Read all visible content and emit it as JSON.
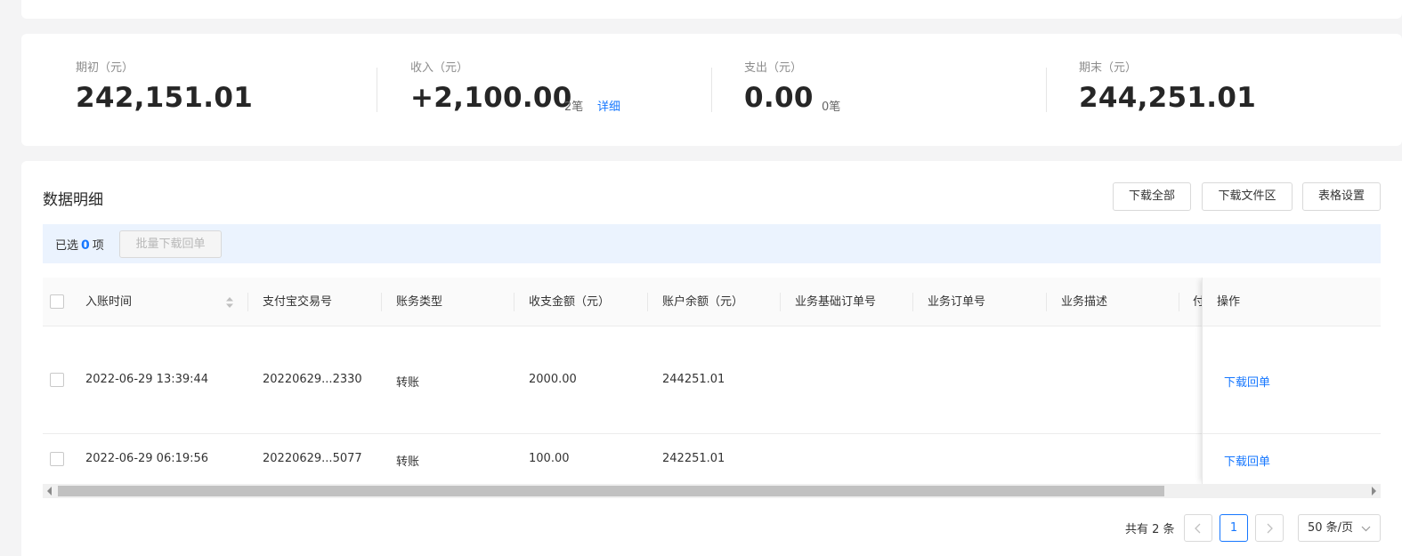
{
  "summary": {
    "opening": {
      "label": "期初（元）",
      "value": "242,151.01"
    },
    "income": {
      "label": "收入（元）",
      "value": "+2,100.00",
      "count": "2笔",
      "detail_link": "详细"
    },
    "expense": {
      "label": "支出（元）",
      "value": "0.00",
      "count": "0笔"
    },
    "closing": {
      "label": "期末（元）",
      "value": "244,251.01"
    }
  },
  "details": {
    "title": "数据明细",
    "buttons": {
      "download_all": "下载全部",
      "download_files": "下载文件区",
      "table_settings": "表格设置"
    },
    "selection": {
      "prefix": "已选",
      "count": "0",
      "suffix": "项",
      "batch_button": "批量下载回单"
    }
  },
  "table": {
    "columns": [
      "入账时间",
      "支付宝交易号",
      "账务类型",
      "收支金额（元）",
      "账户余额（元）",
      "业务基础订单号",
      "业务订单号",
      "业务描述",
      "付"
    ],
    "action_column": "操作",
    "rows": [
      {
        "time": "2022-06-29 13:39:44",
        "trade_no": "20220629...2330",
        "type": "转账",
        "amount": "2000.00",
        "balance": "244251.01",
        "action": "下载回单"
      },
      {
        "time": "2022-06-29 06:19:56",
        "trade_no": "20220629...5077",
        "type": "转账",
        "amount": "100.00",
        "balance": "242251.01",
        "action": "下载回单"
      }
    ]
  },
  "pagination": {
    "total": "共有 2 条",
    "current": "1",
    "page_size": "50 条/页"
  },
  "colors": {
    "accent": "#1677ff",
    "selection_bar": "#ebf3fe"
  }
}
